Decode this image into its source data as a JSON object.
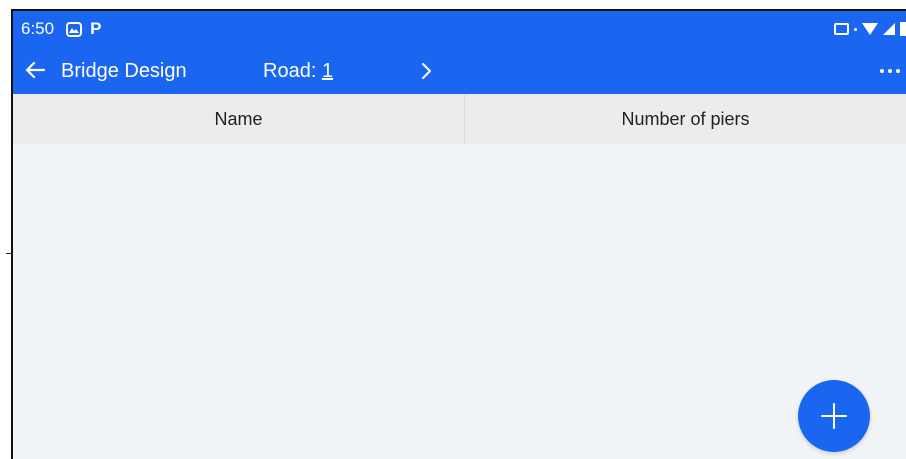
{
  "status_bar": {
    "time": "6:50",
    "notification_icons": [
      "gallery-icon",
      "p-icon"
    ],
    "notif_p_glyph": "P",
    "right_icons": [
      "cast-icon",
      "wifi-icon",
      "signal-icon",
      "battery-icon"
    ]
  },
  "toolbar": {
    "title": "Bridge Design",
    "road_label": "Road: ",
    "road_value": "1",
    "back_icon": "arrow-left-icon",
    "next_icon": "chevron-right-icon",
    "more_icon": "more-horizontal-icon"
  },
  "table": {
    "columns": [
      "Name",
      "Number of piers"
    ],
    "rows": []
  },
  "fab": {
    "icon": "plus-icon"
  },
  "colors": {
    "primary": "#1a66f0",
    "header_bg": "#ececec",
    "body_bg": "#f1f4f6"
  }
}
